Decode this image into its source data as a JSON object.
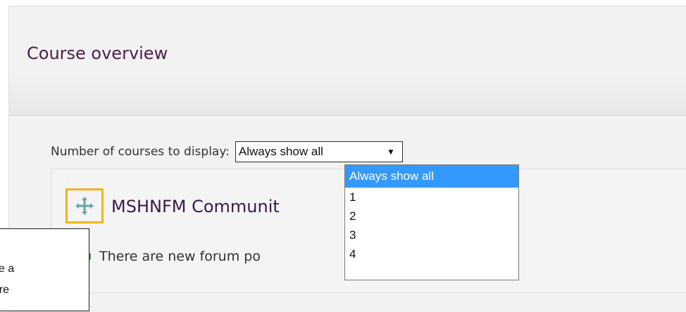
{
  "block": {
    "title": "Course overview"
  },
  "settings": {
    "courses_label": "Number of courses to display:",
    "courses_selected": "Always show all",
    "courses_options": [
      "Always show all",
      "1",
      "2",
      "3",
      "4"
    ]
  },
  "course": {
    "title_visible": "MSHNFM Communit",
    "forum_notice_visible": "There are new forum po"
  },
  "callout": {
    "line1": "ove a",
    "line2": "here"
  },
  "colors": {
    "title": "#4b1e4b",
    "highlight_border": "#f0b41c",
    "selected_option": "#3399ff",
    "move_icon": "#6aa3a8",
    "forum_icon": "#6aa84f"
  },
  "icons": {
    "move": "move-icon",
    "forum": "speech-bubbles-icon",
    "dropdown": "triangle-down-icon"
  }
}
